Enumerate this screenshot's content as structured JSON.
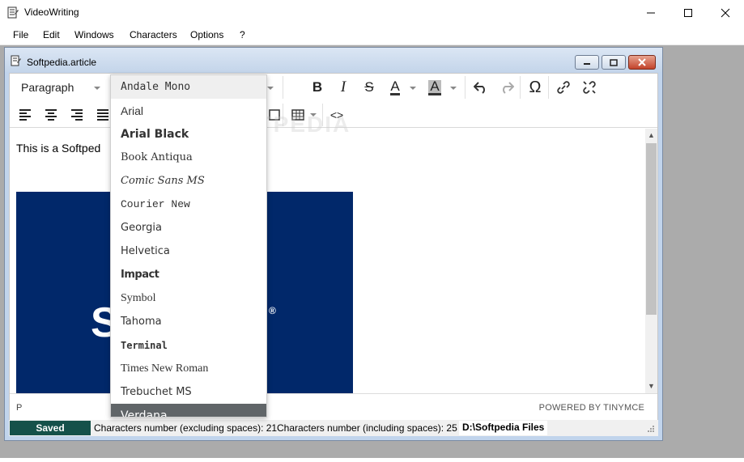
{
  "app": {
    "title": "VideoWriting"
  },
  "menu": [
    "File",
    "Edit",
    "Windows",
    "Characters",
    "Options",
    "?"
  ],
  "document": {
    "title": "Softpedia.article"
  },
  "toolbar": {
    "block_format": "Paragraph",
    "text_color_glyph": "A",
    "bg_color_glyph": "A",
    "omega_glyph": "Ω",
    "code_glyph": "<>"
  },
  "content": {
    "text": "This is a Softped",
    "hero_text": "S              A"
  },
  "font_menu": {
    "options": [
      "Andale Mono",
      "Arial",
      "Arial Black",
      "Book Antiqua",
      "Comic Sans MS",
      "Courier New",
      "Georgia",
      "Helvetica",
      "Impact",
      "Symbol",
      "Tahoma",
      "Terminal",
      "Times New Roman",
      "Trebuchet MS",
      "Verdana"
    ],
    "highlighted": "Verdana"
  },
  "editor_status": {
    "path": "P",
    "powered_by": "POWERED BY TINYMCE"
  },
  "status": {
    "saved": "Saved",
    "chars_excl": "Characters number (excluding spaces): 21",
    "chars_incl": "Characters number (including spaces): 25",
    "folder": "D:\\Softpedia Files"
  },
  "watermark": "SOFTPEDIA",
  "colors": {
    "saved_bg": "#15514a",
    "hero_bg": "#01286a",
    "highlight": "#606568"
  }
}
